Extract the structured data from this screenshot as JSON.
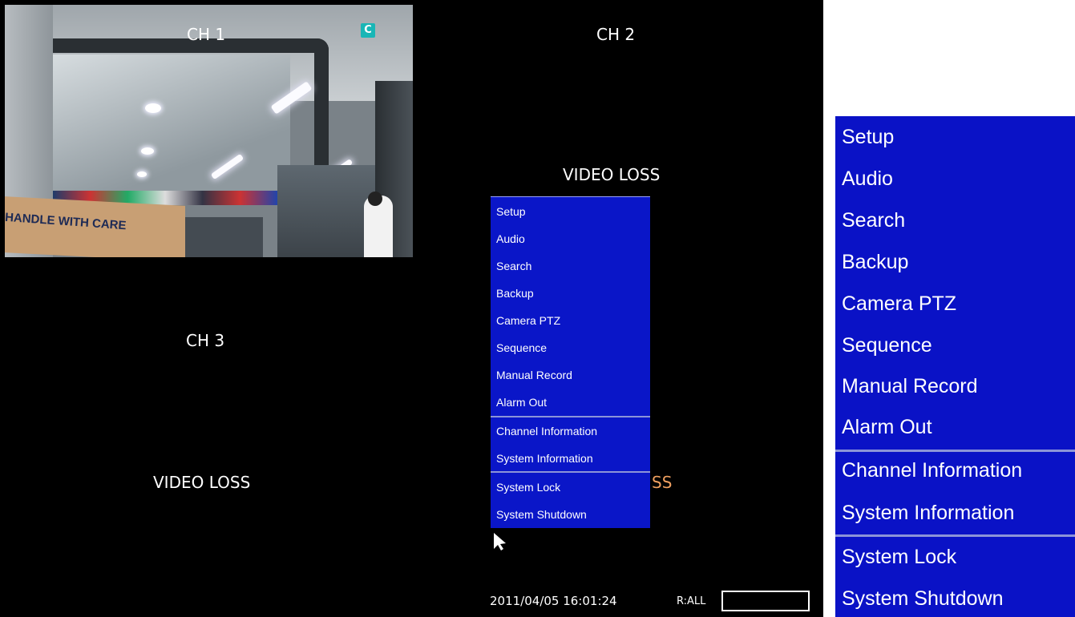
{
  "channels": {
    "ch1": {
      "label": "CH 1",
      "badge": "C"
    },
    "ch2": {
      "label": "CH 2",
      "status": "VIDEO LOSS"
    },
    "ch3": {
      "label": "CH 3",
      "status": "VIDEO LOSS"
    },
    "ch4": {
      "status_partial": "SS"
    }
  },
  "feed": {
    "box_text": "HANDLE WITH CARE"
  },
  "menu": {
    "items": [
      "Setup",
      "Audio",
      "Search",
      "Backup",
      "Camera PTZ",
      "Sequence",
      "Manual Record",
      "Alarm Out",
      "Channel Information",
      "System Information",
      "System Lock",
      "System Shutdown"
    ]
  },
  "status_bar": {
    "datetime": "2011/04/05 16:01:24",
    "record_mode": "R:ALL"
  },
  "colors": {
    "menu_bg": "#0a16c8",
    "background": "#000000",
    "badge": "#18b6b6",
    "partial_text": "#f0a060"
  }
}
